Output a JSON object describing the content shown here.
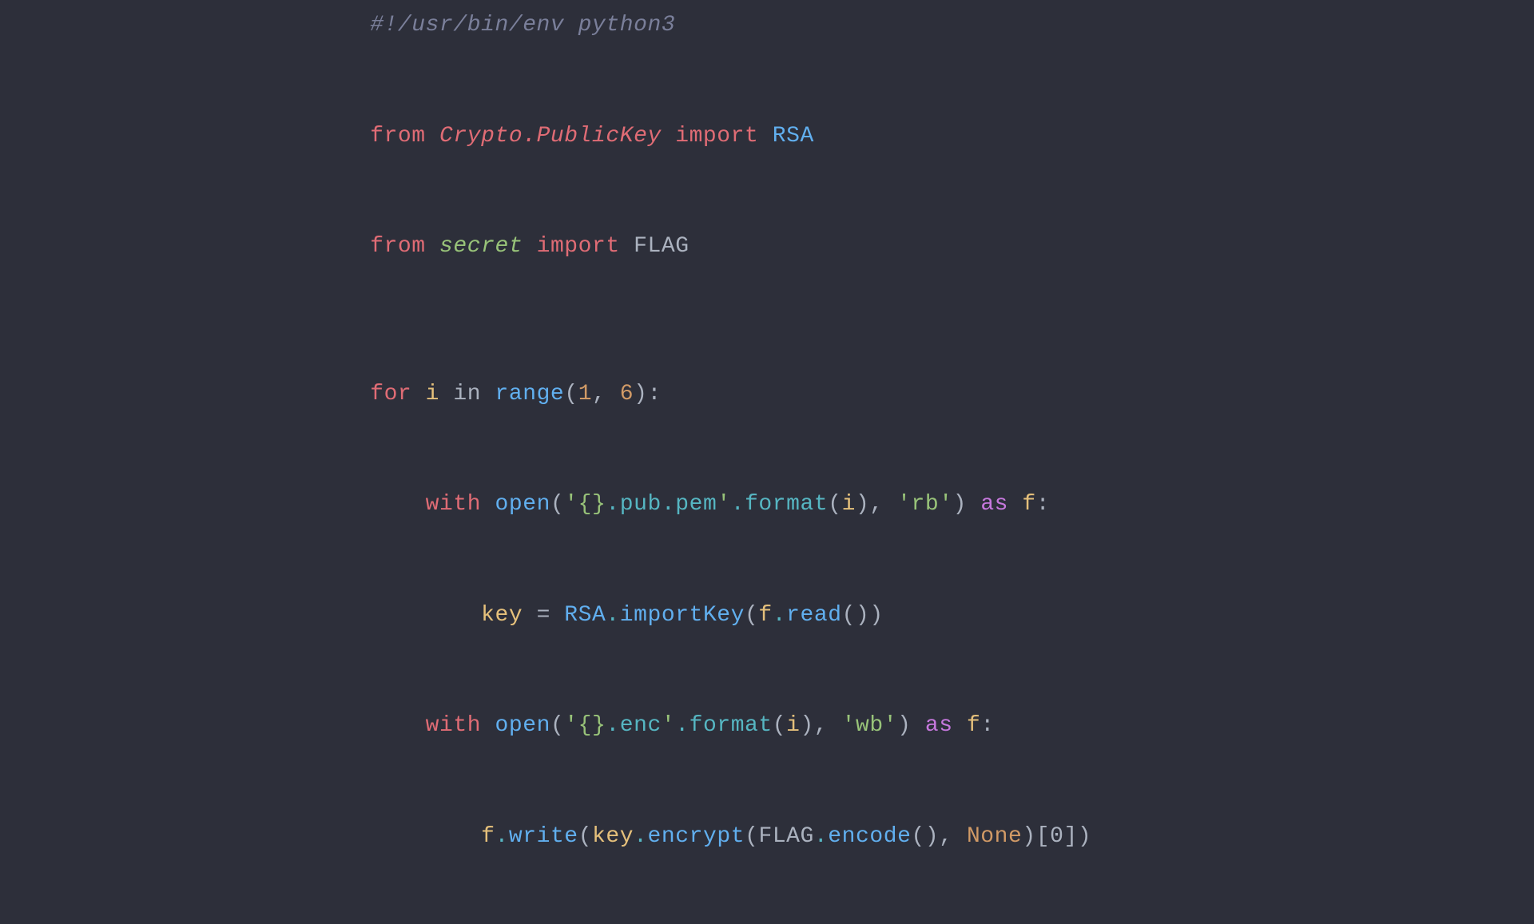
{
  "code": {
    "lines": [
      {
        "id": "shebang",
        "text": "#!/usr/bin/env python3"
      },
      {
        "id": "import1",
        "text": "from Crypto.PublicKey import RSA"
      },
      {
        "id": "import2",
        "text": "from secret import FLAG"
      },
      {
        "id": "blank1",
        "text": ""
      },
      {
        "id": "for",
        "text": "for i in range(1, 6):"
      },
      {
        "id": "with1",
        "text": "    with open('{}.pub.pem'.format(i), 'rb') as f:"
      },
      {
        "id": "importkey",
        "text": "        key = RSA.importKey(f.read())"
      },
      {
        "id": "with2",
        "text": "    with open('{}.enc'.format(i), 'wb') as f:"
      },
      {
        "id": "write",
        "text": "        f.write(key.encrypt(FLAG.encode(), None)[0])"
      }
    ]
  }
}
